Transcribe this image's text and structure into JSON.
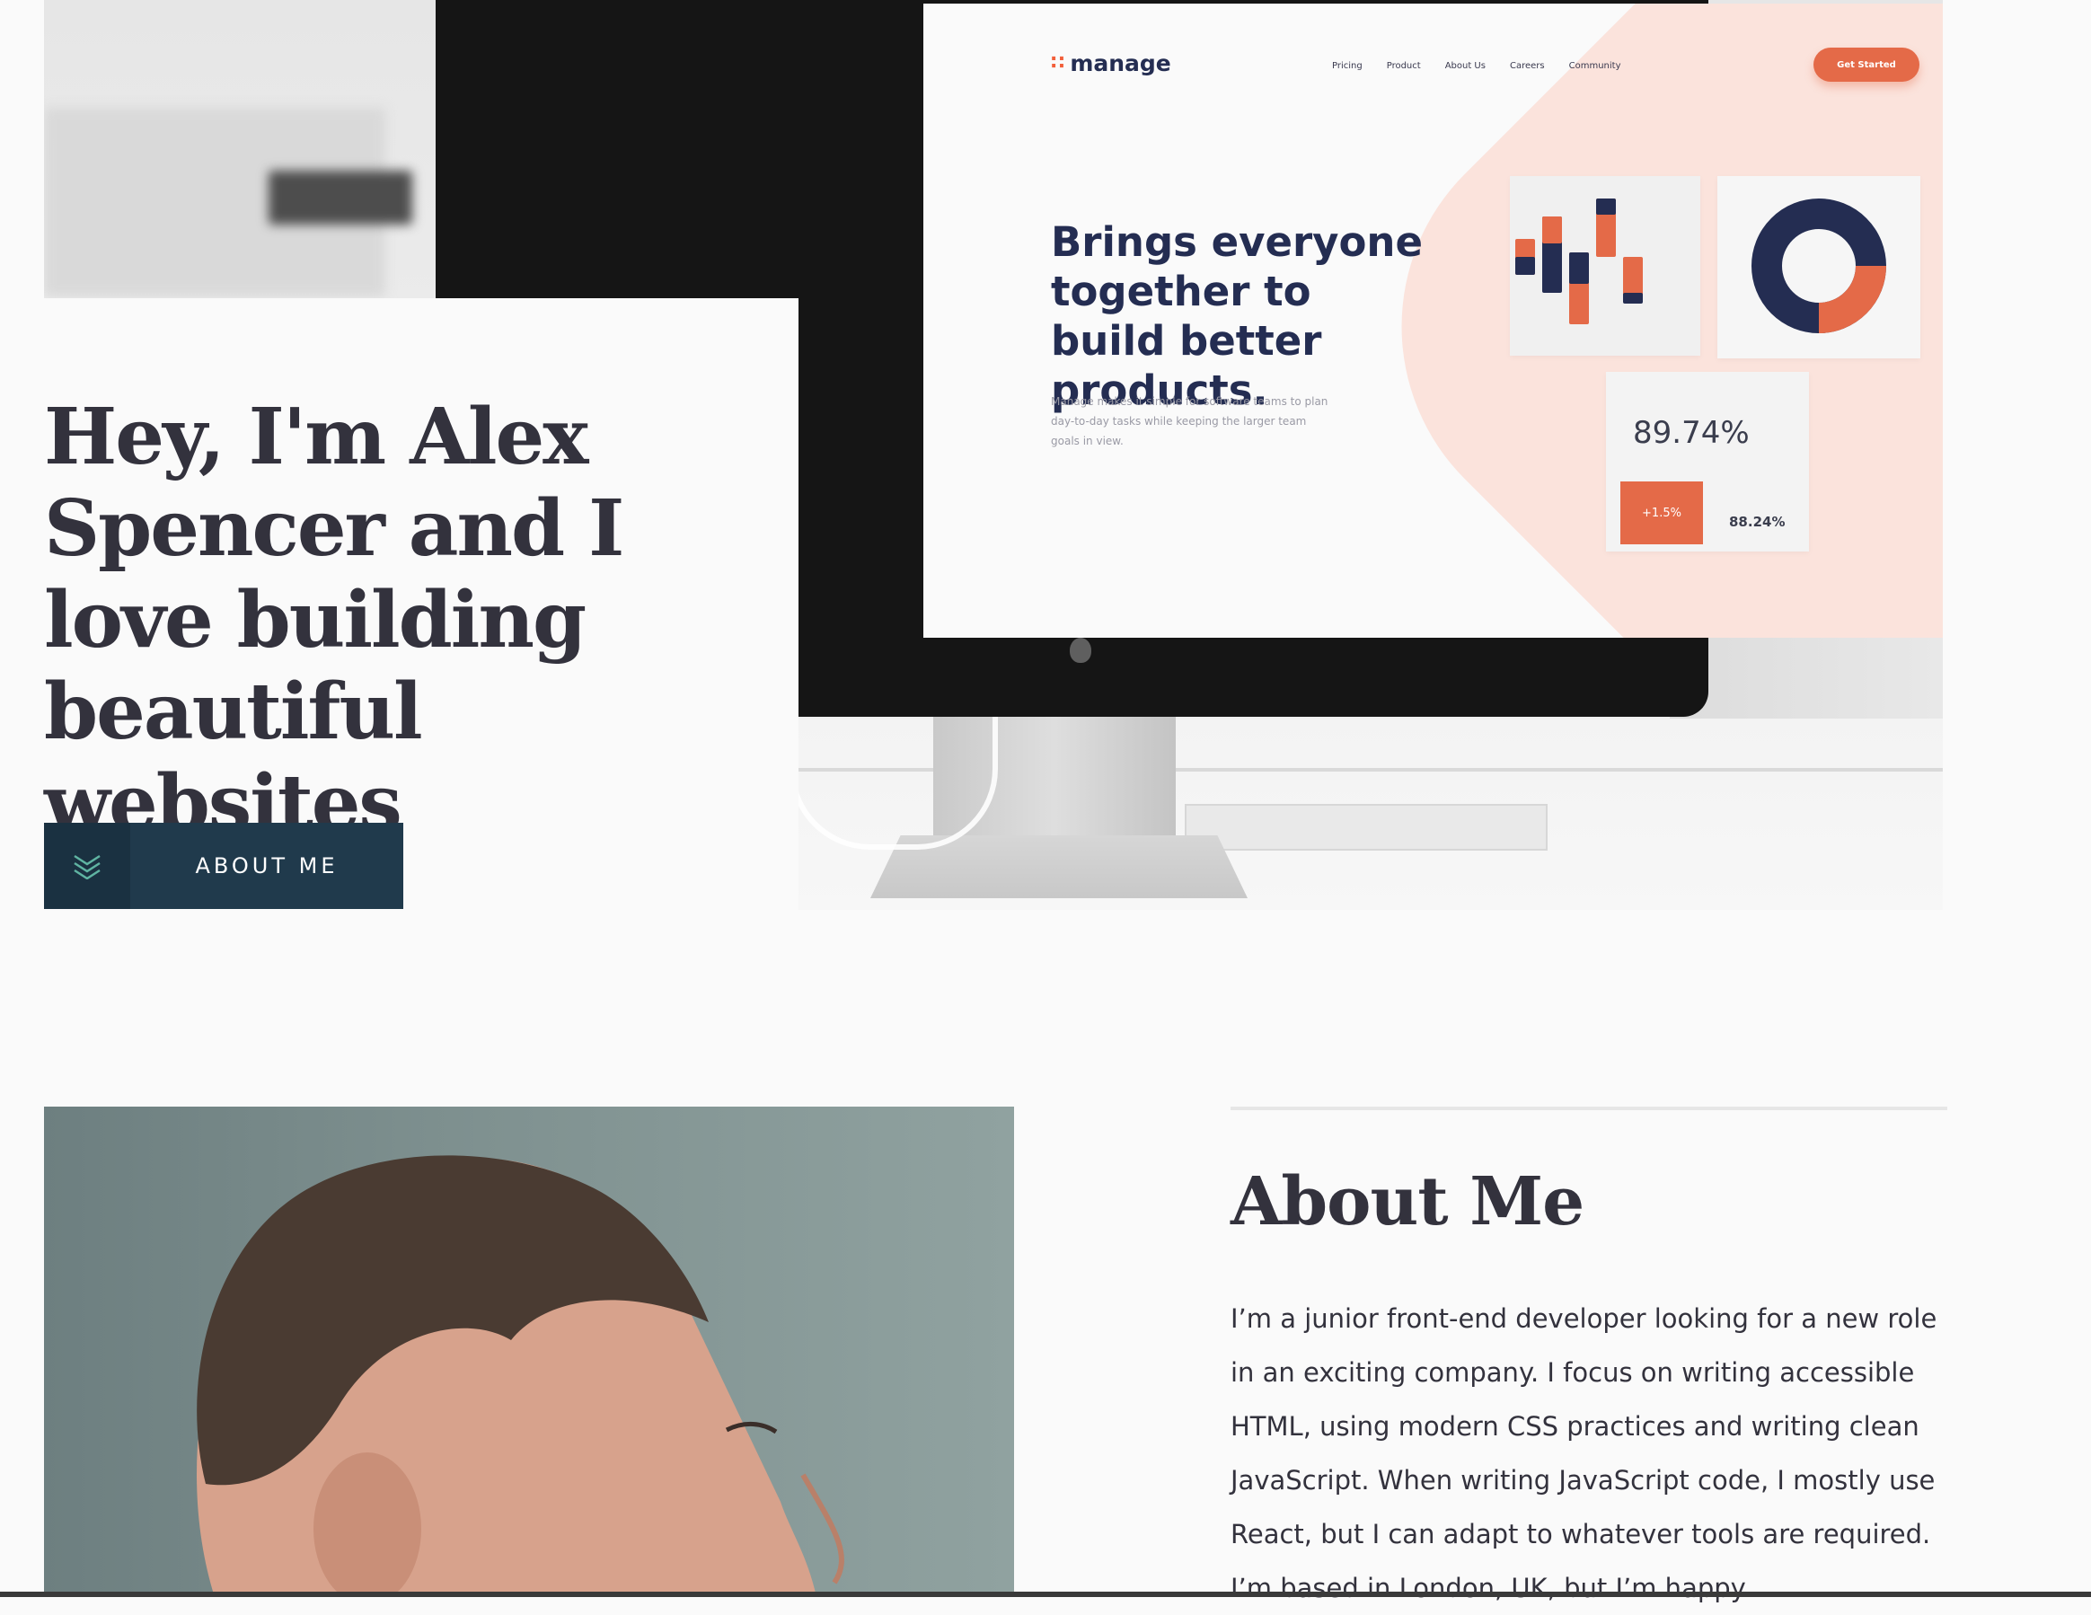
{
  "hero": {
    "title": "Hey, I'm Alex Spencer and I love building beautiful websites",
    "button_label": "ABOUT ME",
    "button_icon": "chevrons-down-icon"
  },
  "screen_site": {
    "logo": "manage",
    "nav": [
      "Pricing",
      "Product",
      "About Us",
      "Careers",
      "Community"
    ],
    "cta": "Get Started",
    "headline": "Brings everyone together to build better products.",
    "subtext": "Manage makes it simple for software teams to plan day-to-day tasks while keeping the larger team goals in view.",
    "stat_main": "89.74%",
    "stat_change": "+1.5%",
    "stat_secondary": "88.24%"
  },
  "about": {
    "heading": "About Me",
    "text": "I’m a junior front-end developer looking for a new role in an exciting company. I focus on writing accessible HTML, using modern CSS practices and writing clean JavaScript. When writing JavaScript code, I mostly use React, but I can adapt to whatever tools are required. I’m based in London, UK, but I’m happy"
  },
  "colors": {
    "background": "#fafafa",
    "text_dark": "#33323d",
    "button_dark": "#203a4c",
    "accent_orange": "#e46a48",
    "navy": "#242d52"
  }
}
